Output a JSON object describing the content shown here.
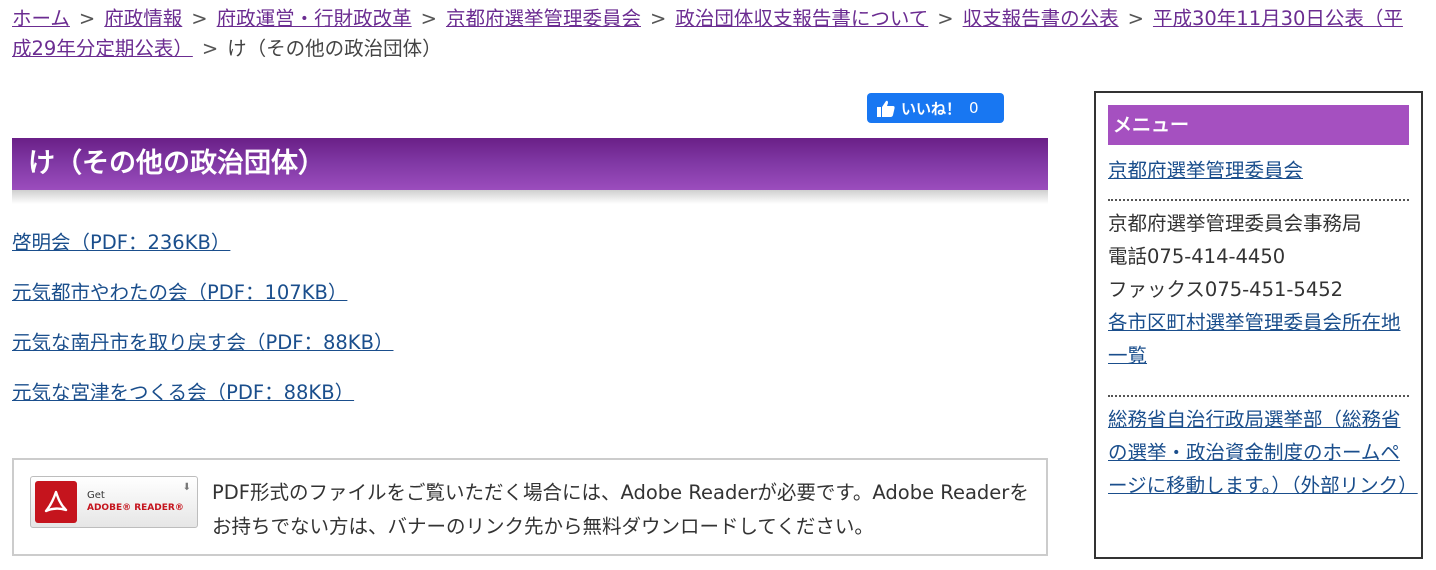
{
  "breadcrumb": {
    "items": [
      "ホーム",
      "府政情報",
      "府政運営・行財政改革",
      "京都府選挙管理委員会",
      "政治団体収支報告書について",
      "収支報告書の公表",
      "平成30年11月30日公表（平成29年分定期公表）"
    ],
    "separator": ">",
    "current": "け（その他の政治団体）"
  },
  "like": {
    "label": "いいね！",
    "count": "0"
  },
  "page_title": "け（その他の政治団体）",
  "documents": [
    "啓明会（PDF：236KB）",
    "元気都市やわたの会（PDF：107KB）",
    "元気な南丹市を取り戻す会（PDF：88KB）",
    "元気な宮津をつくる会（PDF：88KB）"
  ],
  "reader": {
    "banner_get": "Get",
    "banner_product": "ADOBE® READER®",
    "text": "PDF形式のファイルをご覧いただく場合には、Adobe Readerが必要です。Adobe Readerをお持ちでない方は、バナーのリンク先から無料ダウンロードしてください。"
  },
  "menu": {
    "title": "メニュー",
    "link_committee": "京都府選挙管理委員会",
    "office": "京都府選挙管理委員会事務局",
    "phone": "電話075-414-4450",
    "fax": "ファックス075-451-5452",
    "link_offices": "各市区町村選挙管理委員会所在地一覧",
    "link_external": "総務省自治行政局選挙部（総務省の選挙・政治資金制度のホームページに移動します。）（外部リンク）"
  },
  "colors": {
    "title_bar": "#7f37a3",
    "menu_head": "#a550c0",
    "like_button": "#1877f2",
    "link": "#1a4e8c",
    "visited_link": "#6b2c91"
  }
}
